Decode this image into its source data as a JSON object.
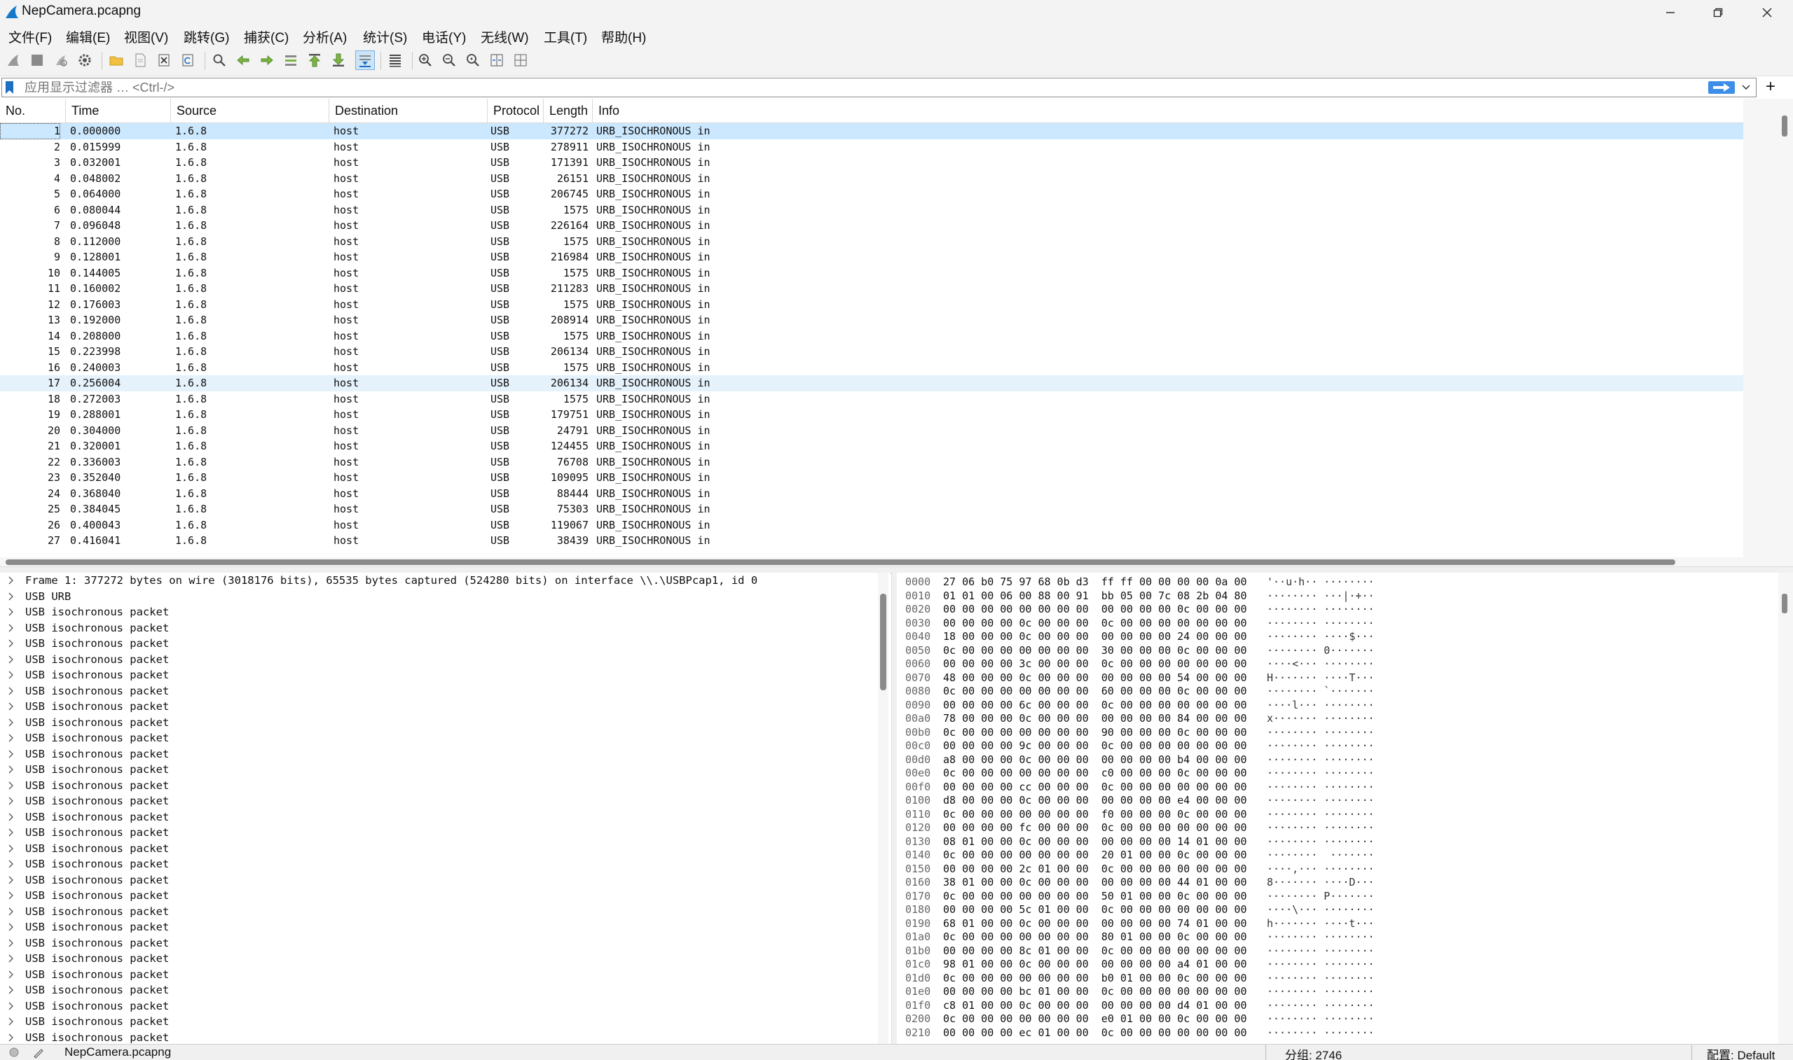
{
  "window": {
    "title": "NepCamera.pcapng",
    "controls": {
      "minimize": "minimize-icon",
      "maximize": "maximize-icon",
      "close": "close-icon"
    }
  },
  "menu": [
    {
      "label": "文件(F)"
    },
    {
      "label": "编辑(E)"
    },
    {
      "label": "视图(V)"
    },
    {
      "label": "跳转(G)"
    },
    {
      "label": "捕获(C)"
    },
    {
      "label": "分析(A)"
    },
    {
      "label": "统计(S)"
    },
    {
      "label": "电话(Y)"
    },
    {
      "label": "无线(W)"
    },
    {
      "label": "工具(T)"
    },
    {
      "label": "帮助(H)"
    }
  ],
  "filter": {
    "placeholder": "应用显示过滤器 … <Ctrl-/>",
    "add_label": "+"
  },
  "packet_list": {
    "columns": [
      "No.",
      "Time",
      "Source",
      "Destination",
      "Protocol",
      "Length",
      "Info"
    ],
    "selected_row": 1,
    "rows": [
      {
        "no": "1",
        "time": "0.000000",
        "src": "1.6.8",
        "dst": "host",
        "proto": "USB",
        "len": "377272",
        "info": "URB_ISOCHRONOUS in"
      },
      {
        "no": "2",
        "time": "0.015999",
        "src": "1.6.8",
        "dst": "host",
        "proto": "USB",
        "len": "278911",
        "info": "URB_ISOCHRONOUS in"
      },
      {
        "no": "3",
        "time": "0.032001",
        "src": "1.6.8",
        "dst": "host",
        "proto": "USB",
        "len": "171391",
        "info": "URB_ISOCHRONOUS in"
      },
      {
        "no": "4",
        "time": "0.048002",
        "src": "1.6.8",
        "dst": "host",
        "proto": "USB",
        "len": "26151",
        "info": "URB_ISOCHRONOUS in"
      },
      {
        "no": "5",
        "time": "0.064000",
        "src": "1.6.8",
        "dst": "host",
        "proto": "USB",
        "len": "206745",
        "info": "URB_ISOCHRONOUS in"
      },
      {
        "no": "6",
        "time": "0.080044",
        "src": "1.6.8",
        "dst": "host",
        "proto": "USB",
        "len": "1575",
        "info": "URB_ISOCHRONOUS in"
      },
      {
        "no": "7",
        "time": "0.096048",
        "src": "1.6.8",
        "dst": "host",
        "proto": "USB",
        "len": "226164",
        "info": "URB_ISOCHRONOUS in"
      },
      {
        "no": "8",
        "time": "0.112000",
        "src": "1.6.8",
        "dst": "host",
        "proto": "USB",
        "len": "1575",
        "info": "URB_ISOCHRONOUS in"
      },
      {
        "no": "9",
        "time": "0.128001",
        "src": "1.6.8",
        "dst": "host",
        "proto": "USB",
        "len": "216984",
        "info": "URB_ISOCHRONOUS in"
      },
      {
        "no": "10",
        "time": "0.144005",
        "src": "1.6.8",
        "dst": "host",
        "proto": "USB",
        "len": "1575",
        "info": "URB_ISOCHRONOUS in"
      },
      {
        "no": "11",
        "time": "0.160002",
        "src": "1.6.8",
        "dst": "host",
        "proto": "USB",
        "len": "211283",
        "info": "URB_ISOCHRONOUS in"
      },
      {
        "no": "12",
        "time": "0.176003",
        "src": "1.6.8",
        "dst": "host",
        "proto": "USB",
        "len": "1575",
        "info": "URB_ISOCHRONOUS in"
      },
      {
        "no": "13",
        "time": "0.192000",
        "src": "1.6.8",
        "dst": "host",
        "proto": "USB",
        "len": "208914",
        "info": "URB_ISOCHRONOUS in"
      },
      {
        "no": "14",
        "time": "0.208000",
        "src": "1.6.8",
        "dst": "host",
        "proto": "USB",
        "len": "1575",
        "info": "URB_ISOCHRONOUS in"
      },
      {
        "no": "15",
        "time": "0.223998",
        "src": "1.6.8",
        "dst": "host",
        "proto": "USB",
        "len": "206134",
        "info": "URB_ISOCHRONOUS in"
      },
      {
        "no": "16",
        "time": "0.240003",
        "src": "1.6.8",
        "dst": "host",
        "proto": "USB",
        "len": "1575",
        "info": "URB_ISOCHRONOUS in"
      },
      {
        "no": "17",
        "time": "0.256004",
        "src": "1.6.8",
        "dst": "host",
        "proto": "USB",
        "len": "206134",
        "info": "URB_ISOCHRONOUS in"
      },
      {
        "no": "18",
        "time": "0.272003",
        "src": "1.6.8",
        "dst": "host",
        "proto": "USB",
        "len": "1575",
        "info": "URB_ISOCHRONOUS in"
      },
      {
        "no": "19",
        "time": "0.288001",
        "src": "1.6.8",
        "dst": "host",
        "proto": "USB",
        "len": "179751",
        "info": "URB_ISOCHRONOUS in"
      },
      {
        "no": "20",
        "time": "0.304000",
        "src": "1.6.8",
        "dst": "host",
        "proto": "USB",
        "len": "24791",
        "info": "URB_ISOCHRONOUS in"
      },
      {
        "no": "21",
        "time": "0.320001",
        "src": "1.6.8",
        "dst": "host",
        "proto": "USB",
        "len": "124455",
        "info": "URB_ISOCHRONOUS in"
      },
      {
        "no": "22",
        "time": "0.336003",
        "src": "1.6.8",
        "dst": "host",
        "proto": "USB",
        "len": "76708",
        "info": "URB_ISOCHRONOUS in"
      },
      {
        "no": "23",
        "time": "0.352040",
        "src": "1.6.8",
        "dst": "host",
        "proto": "USB",
        "len": "109095",
        "info": "URB_ISOCHRONOUS in"
      },
      {
        "no": "24",
        "time": "0.368040",
        "src": "1.6.8",
        "dst": "host",
        "proto": "USB",
        "len": "88444",
        "info": "URB_ISOCHRONOUS in"
      },
      {
        "no": "25",
        "time": "0.384045",
        "src": "1.6.8",
        "dst": "host",
        "proto": "USB",
        "len": "75303",
        "info": "URB_ISOCHRONOUS in"
      },
      {
        "no": "26",
        "time": "0.400043",
        "src": "1.6.8",
        "dst": "host",
        "proto": "USB",
        "len": "119067",
        "info": "URB_ISOCHRONOUS in"
      },
      {
        "no": "27",
        "time": "0.416041",
        "src": "1.6.8",
        "dst": "host",
        "proto": "USB",
        "len": "38439",
        "info": "URB_ISOCHRONOUS in"
      }
    ]
  },
  "details": [
    "Frame 1: 377272 bytes on wire (3018176 bits), 65535 bytes captured (524280 bits) on interface \\\\.\\USBPcap1, id 0",
    "USB URB",
    "USB isochronous packet",
    "USB isochronous packet",
    "USB isochronous packet",
    "USB isochronous packet",
    "USB isochronous packet",
    "USB isochronous packet",
    "USB isochronous packet",
    "USB isochronous packet",
    "USB isochronous packet",
    "USB isochronous packet",
    "USB isochronous packet",
    "USB isochronous packet",
    "USB isochronous packet",
    "USB isochronous packet",
    "USB isochronous packet",
    "USB isochronous packet",
    "USB isochronous packet",
    "USB isochronous packet",
    "USB isochronous packet",
    "USB isochronous packet",
    "USB isochronous packet",
    "USB isochronous packet",
    "USB isochronous packet",
    "USB isochronous packet",
    "USB isochronous packet",
    "USB isochronous packet",
    "USB isochronous packet",
    "USB isochronous packet",
    "USB isochronous packet"
  ],
  "bytes": [
    {
      "off": "0000",
      "hex": "27 06 b0 75 97 68 0b d3  ff ff 00 00 00 00 0a 00",
      "ascii": "'··u·h·· ········"
    },
    {
      "off": "0010",
      "hex": "01 01 00 06 00 88 00 91  bb 05 00 7c 08 2b 04 80",
      "ascii": "········ ···|·+··"
    },
    {
      "off": "0020",
      "hex": "00 00 00 00 00 00 00 00  00 00 00 00 0c 00 00 00",
      "ascii": "········ ········"
    },
    {
      "off": "0030",
      "hex": "00 00 00 00 0c 00 00 00  0c 00 00 00 00 00 00 00",
      "ascii": "········ ········"
    },
    {
      "off": "0040",
      "hex": "18 00 00 00 0c 00 00 00  00 00 00 00 24 00 00 00",
      "ascii": "········ ····$···"
    },
    {
      "off": "0050",
      "hex": "0c 00 00 00 00 00 00 00  30 00 00 00 0c 00 00 00",
      "ascii": "········ 0·······"
    },
    {
      "off": "0060",
      "hex": "00 00 00 00 3c 00 00 00  0c 00 00 00 00 00 00 00",
      "ascii": "····<··· ········"
    },
    {
      "off": "0070",
      "hex": "48 00 00 00 0c 00 00 00  00 00 00 00 54 00 00 00",
      "ascii": "H······· ····T···"
    },
    {
      "off": "0080",
      "hex": "0c 00 00 00 00 00 00 00  60 00 00 00 0c 00 00 00",
      "ascii": "········ `·······"
    },
    {
      "off": "0090",
      "hex": "00 00 00 00 6c 00 00 00  0c 00 00 00 00 00 00 00",
      "ascii": "····l··· ········"
    },
    {
      "off": "00a0",
      "hex": "78 00 00 00 0c 00 00 00  00 00 00 00 84 00 00 00",
      "ascii": "x······· ········"
    },
    {
      "off": "00b0",
      "hex": "0c 00 00 00 00 00 00 00  90 00 00 00 0c 00 00 00",
      "ascii": "········ ········"
    },
    {
      "off": "00c0",
      "hex": "00 00 00 00 9c 00 00 00  0c 00 00 00 00 00 00 00",
      "ascii": "········ ········"
    },
    {
      "off": "00d0",
      "hex": "a8 00 00 00 0c 00 00 00  00 00 00 00 b4 00 00 00",
      "ascii": "········ ········"
    },
    {
      "off": "00e0",
      "hex": "0c 00 00 00 00 00 00 00  c0 00 00 00 0c 00 00 00",
      "ascii": "········ ········"
    },
    {
      "off": "00f0",
      "hex": "00 00 00 00 cc 00 00 00  0c 00 00 00 00 00 00 00",
      "ascii": "········ ········"
    },
    {
      "off": "0100",
      "hex": "d8 00 00 00 0c 00 00 00  00 00 00 00 e4 00 00 00",
      "ascii": "········ ········"
    },
    {
      "off": "0110",
      "hex": "0c 00 00 00 00 00 00 00  f0 00 00 00 0c 00 00 00",
      "ascii": "········ ········"
    },
    {
      "off": "0120",
      "hex": "00 00 00 00 fc 00 00 00  0c 00 00 00 00 00 00 00",
      "ascii": "········ ········"
    },
    {
      "off": "0130",
      "hex": "08 01 00 00 0c 00 00 00  00 00 00 00 14 01 00 00",
      "ascii": "········ ········"
    },
    {
      "off": "0140",
      "hex": "0c 00 00 00 00 00 00 00  20 01 00 00 0c 00 00 00",
      "ascii": "········  ·······"
    },
    {
      "off": "0150",
      "hex": "00 00 00 00 2c 01 00 00  0c 00 00 00 00 00 00 00",
      "ascii": "····,··· ········"
    },
    {
      "off": "0160",
      "hex": "38 01 00 00 0c 00 00 00  00 00 00 00 44 01 00 00",
      "ascii": "8······· ····D···"
    },
    {
      "off": "0170",
      "hex": "0c 00 00 00 00 00 00 00  50 01 00 00 0c 00 00 00",
      "ascii": "········ P·······"
    },
    {
      "off": "0180",
      "hex": "00 00 00 00 5c 01 00 00  0c 00 00 00 00 00 00 00",
      "ascii": "····\\··· ········"
    },
    {
      "off": "0190",
      "hex": "68 01 00 00 0c 00 00 00  00 00 00 00 74 01 00 00",
      "ascii": "h······· ····t···"
    },
    {
      "off": "01a0",
      "hex": "0c 00 00 00 00 00 00 00  80 01 00 00 0c 00 00 00",
      "ascii": "········ ········"
    },
    {
      "off": "01b0",
      "hex": "00 00 00 00 8c 01 00 00  0c 00 00 00 00 00 00 00",
      "ascii": "········ ········"
    },
    {
      "off": "01c0",
      "hex": "98 01 00 00 0c 00 00 00  00 00 00 00 a4 01 00 00",
      "ascii": "········ ········"
    },
    {
      "off": "01d0",
      "hex": "0c 00 00 00 00 00 00 00  b0 01 00 00 0c 00 00 00",
      "ascii": "········ ········"
    },
    {
      "off": "01e0",
      "hex": "00 00 00 00 bc 01 00 00  0c 00 00 00 00 00 00 00",
      "ascii": "········ ········"
    },
    {
      "off": "01f0",
      "hex": "c8 01 00 00 0c 00 00 00  00 00 00 00 d4 01 00 00",
      "ascii": "········ ········"
    },
    {
      "off": "0200",
      "hex": "0c 00 00 00 00 00 00 00  e0 01 00 00 0c 00 00 00",
      "ascii": "········ ········"
    },
    {
      "off": "0210",
      "hex": "00 00 00 00 ec 01 00 00  0c 00 00 00 00 00 00 00",
      "ascii": "········ ········"
    }
  ],
  "status": {
    "file": "NepCamera.pcapng",
    "packets": "分组: 2746",
    "profile": "配置: Default"
  }
}
